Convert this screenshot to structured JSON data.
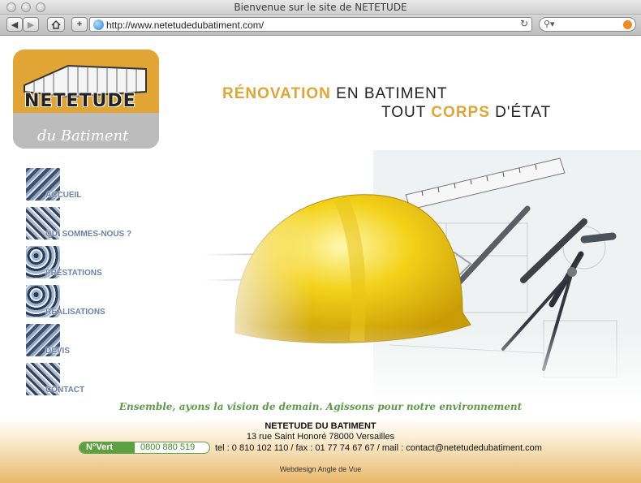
{
  "browser": {
    "window_title": "Bienvenue sur le site de NETETUDE",
    "url": "http://www.netetudedubatiment.com/",
    "back_icon": "back-arrow-icon",
    "forward_icon": "forward-arrow-icon",
    "home_icon": "home-icon",
    "add_icon": "plus-icon",
    "reload_icon": "reload-icon",
    "search_icon": "search-icon"
  },
  "logo": {
    "brand": "NETETUDE",
    "script": "du Batiment"
  },
  "headline": {
    "line1_orange": "RÉNOVATION",
    "line1_dark": "EN BATIMENT",
    "line2_a": "TOUT",
    "line2_orange": "CORPS",
    "line2_b": "D'ÉTAT"
  },
  "menu": {
    "items": [
      {
        "label": "ACCUEIL"
      },
      {
        "label": "QUI SOMMES-NOUS ?"
      },
      {
        "label": "PRESTATIONS"
      },
      {
        "label": "REALISATIONS"
      },
      {
        "label": "DEVIS"
      },
      {
        "label": "CONTACT"
      }
    ]
  },
  "slogan": "Ensemble, ayons la vision de demain. Agissons pour notre environnement",
  "footer": {
    "company": "NETETUDE DU BATIMENT",
    "address": "13 rue Saint Honoré 78000 Versailles",
    "numero_vert_tag": "N°Vert",
    "numero_vert": "0800 880 519",
    "contact": "tel : 0 810 102 110 / fax : 01 77 74 67 67 / mail : contact@netetudedubatiment.com",
    "credit": "Webdesign Angle de Vue"
  },
  "colors": {
    "accent_orange": "#e0a535",
    "menu_blue": "#6c84a8",
    "slogan_green": "#5d9b48"
  }
}
